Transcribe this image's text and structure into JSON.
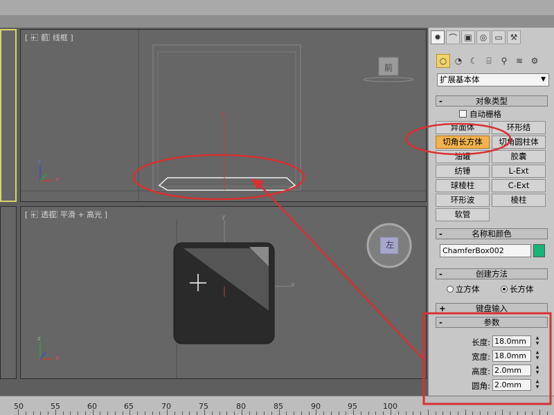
{
  "viewports": {
    "front": {
      "label": "[ + ⃞ 前 ⃞ 线框 ]",
      "cube_label": "前"
    },
    "perspective": {
      "label": "[ + ⃞ 透视 ⃞ 平滑 + 高光 ]",
      "cube_label": "左"
    }
  },
  "command_panel": {
    "tab_icons": [
      "create-icon",
      "modify-icon",
      "hierarchy-icon",
      "motion-icon",
      "display-icon",
      "utilities-icon"
    ],
    "sub_icons": [
      "geometry-icon",
      "shapes-icon",
      "lights-icon",
      "cameras-icon",
      "helpers-icon",
      "spacewarps-icon",
      "systems-icon"
    ],
    "category": "扩展基本体",
    "object_type": {
      "title": "对象类型",
      "autogrid": "自动栅格",
      "buttons": [
        "异面体",
        "环形结",
        "切角长方体",
        "切角圆柱体",
        "油罐",
        "胶囊",
        "纺锤",
        "L-Ext",
        "球棱柱",
        "C-Ext",
        "环形波",
        "棱柱",
        "软管"
      ],
      "active_button": "切角长方体"
    },
    "name_color": {
      "title": "名称和颜色",
      "name": "ChamferBox002",
      "color": "#18b478"
    },
    "creation_method": {
      "title": "创建方法",
      "option_cube": "立方体",
      "option_box": "长方体",
      "selected": "长方体"
    },
    "keyboard_entry": {
      "title": "键盘输入"
    },
    "parameters": {
      "title": "参数",
      "fields": [
        {
          "label": "长度:",
          "value": "18.0mm"
        },
        {
          "label": "宽度:",
          "value": "18.0mm"
        },
        {
          "label": "高度:",
          "value": "2.0mm"
        },
        {
          "label": "圆角:",
          "value": "2.0mm"
        }
      ]
    }
  },
  "ruler": {
    "numbers": [
      "50",
      "55",
      "60",
      "65",
      "70",
      "75",
      "80",
      "85",
      "90",
      "95",
      "100"
    ]
  },
  "axes": {
    "x": "x",
    "y": "y",
    "z": "z"
  },
  "annotations": {
    "highlight_color": "#d93030"
  }
}
